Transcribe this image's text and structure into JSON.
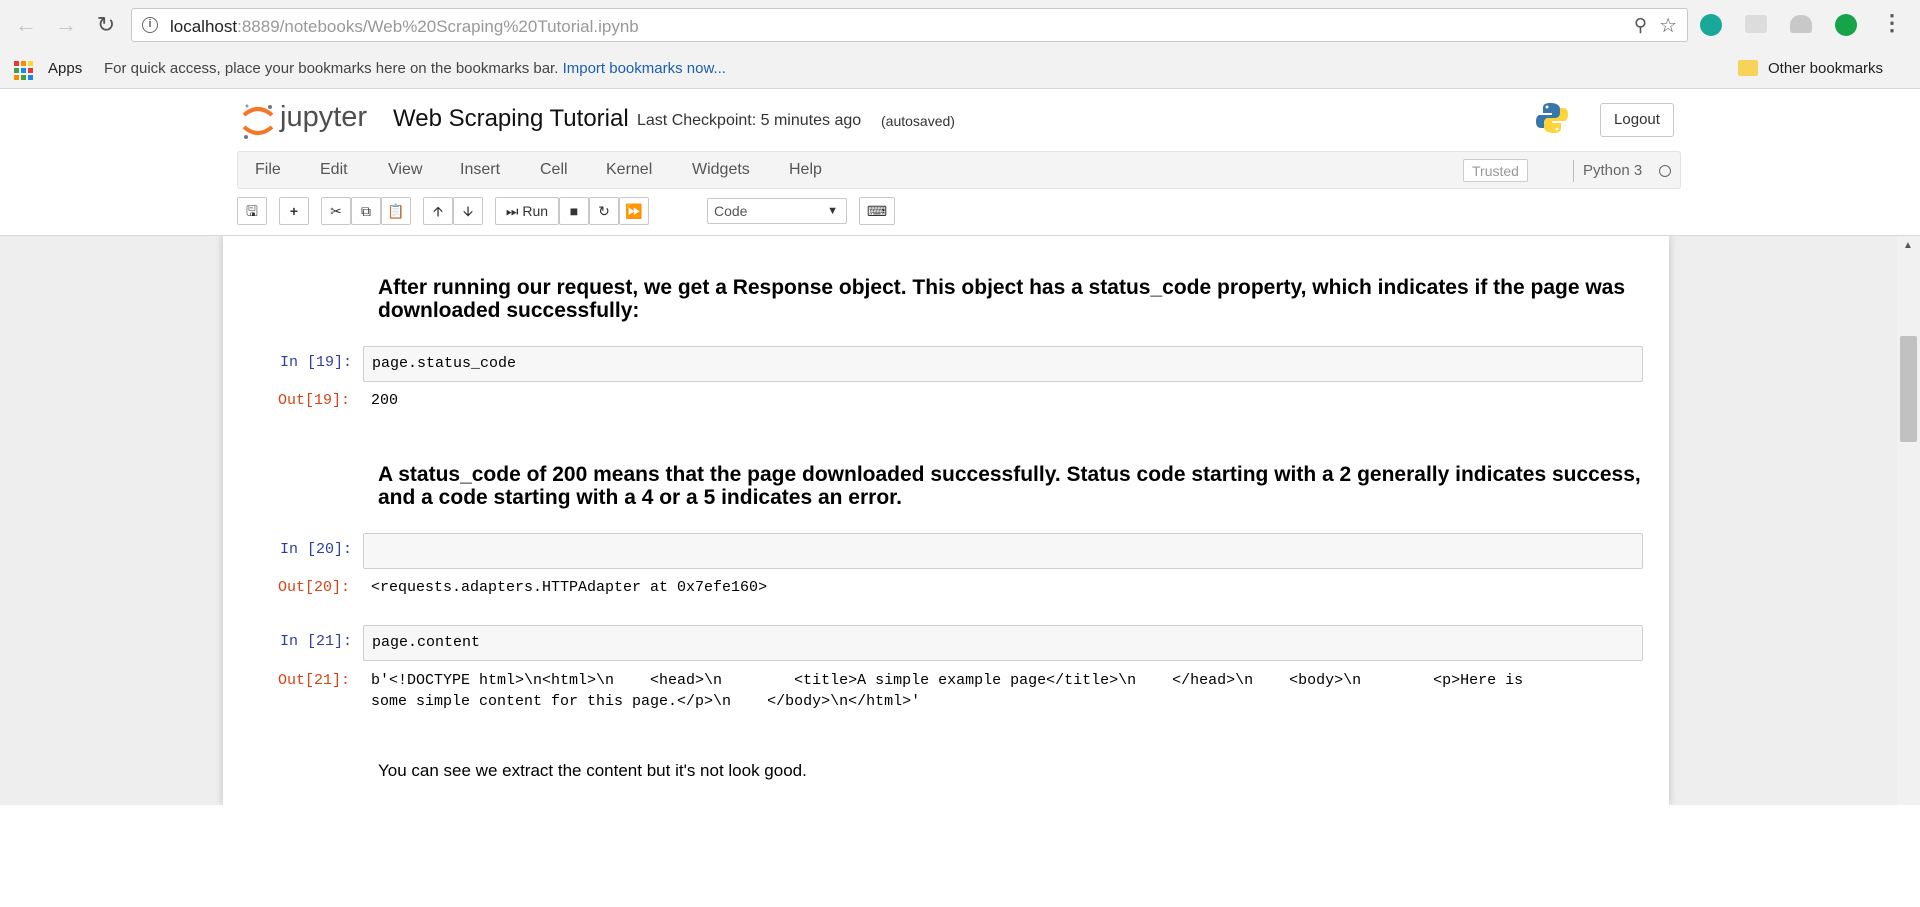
{
  "browser": {
    "url_host": "localhost",
    "url_rest": ":8889/notebooks/Web%20Scraping%20Tutorial.ipynb",
    "bookmarks": {
      "apps_label": "Apps",
      "hint": "For quick access, place your bookmarks here on the bookmarks bar.",
      "import_link": "Import bookmarks now...",
      "other": "Other bookmarks"
    }
  },
  "jupyter": {
    "logo_text": "jupyter",
    "notebook_name": "Web Scraping Tutorial",
    "checkpoint": "Last Checkpoint: 5 minutes ago",
    "autosaved": "(autosaved)",
    "logout_label": "Logout",
    "menu": [
      "File",
      "Edit",
      "View",
      "Insert",
      "Cell",
      "Kernel",
      "Widgets",
      "Help"
    ],
    "trusted_label": "Trusted",
    "kernel": "Python 3",
    "toolbar": {
      "run_label": "Run",
      "cell_type": "Code"
    }
  },
  "cells": {
    "md1": "After running our request, we get a Response object. This object has a status_code property, which indicates if the page was downloaded successfully:",
    "in19_prompt": "In [19]:",
    "in19_code": "page.status_code",
    "out19_prompt": "Out[19]:",
    "out19_value": "200",
    "md2": "A status_code of 200 means that the page downloaded successfully. Status code starting with a 2 generally indicates success, and a code starting with a 4 or a 5 indicates an error.",
    "in20_prompt": "In [20]:",
    "in20_code": "",
    "out20_prompt": "Out[20]:",
    "out20_value": "<requests.adapters.HTTPAdapter at 0x7efe160>",
    "in21_prompt": "In [21]:",
    "in21_code": "page.content",
    "out21_prompt": "Out[21]:",
    "out21_line1": "b'<!DOCTYPE html>\\n<html>\\n    <head>\\n        <title>A simple example page</title>\\n    </head>\\n    <body>\\n        <p>Here is",
    "out21_line2": "some simple content for this page.</p>\\n    </body>\\n</html>'",
    "md3": "You can see we extract the content but it's not look good."
  },
  "colors": {
    "prompt_in": "#303F9F",
    "prompt_out": "#D84315",
    "jupyter_orange": "#F37726"
  }
}
